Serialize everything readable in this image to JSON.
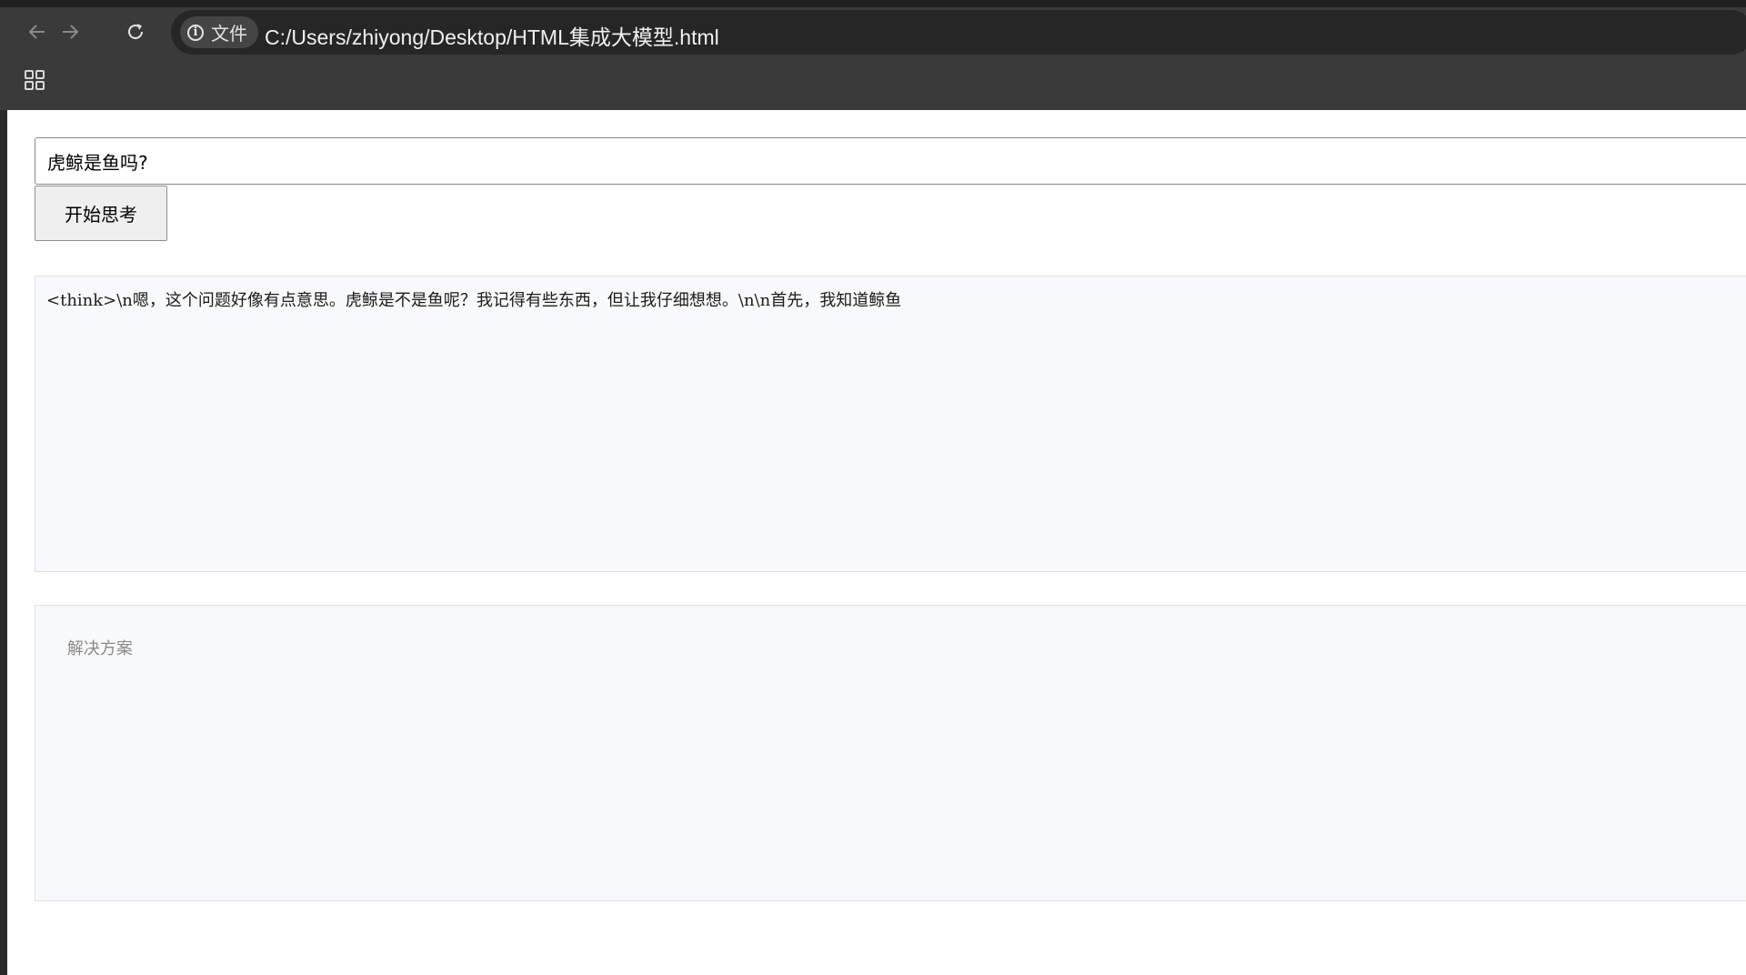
{
  "browser": {
    "nav": {
      "back_icon": "arrow-left-icon",
      "forward_icon": "arrow-right-icon",
      "reload_icon": "reload-icon"
    },
    "site_chip_label": "文件",
    "url": "C:/Users/zhiyong/Desktop/HTML集成大模型.html",
    "apps_icon": "grid-icon"
  },
  "page": {
    "question_input_value": "虎鲸是鱼吗?",
    "start_button_label": "开始思考",
    "think_output": "<think>\\n嗯，这个问题好像有点意思。虎鲸是不是鱼呢？我记得有些东西，但让我仔细想想。\\n\\n首先，我知道鲸鱼",
    "solution_placeholder": "解决方案"
  },
  "colors": {
    "chrome_bg": "#3a3a3a",
    "omnibox_bg": "#262626",
    "panel_bg": "#f8f9fa",
    "button_bg": "#efefef"
  }
}
